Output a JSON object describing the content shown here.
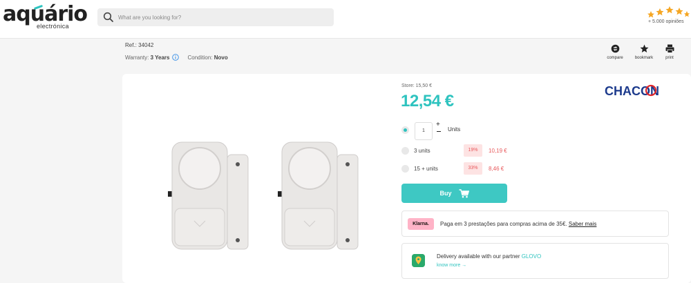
{
  "header": {
    "logo_main": "aquário",
    "logo_sub": "electrónica",
    "search_placeholder": "What are you looking for?",
    "rating_text": "+ 5.000 opiniões",
    "icons": {
      "search": "search-icon",
      "stars": "star-icon"
    },
    "colors": {
      "stars": "#f5a623",
      "accent": "#2ec3bf"
    }
  },
  "product": {
    "ref": "Ref.: 34042",
    "warranty_label": "Warranty:",
    "warranty_value": "3 Years",
    "condition_label": "Condition:",
    "condition_value": "Novo",
    "store_price": "Store: 15,50 €",
    "price": "12,54 €",
    "brand": "CHACON",
    "brand_color": "#1c3a8c"
  },
  "actions": {
    "compare": "compare",
    "bookmark": "bookmark",
    "print": "print"
  },
  "purchase": {
    "quantity": "1",
    "qty_plus": "+",
    "units_label": "Units",
    "tiers": [
      {
        "label": "3 units",
        "discount": "19%",
        "price": "10,19 €"
      },
      {
        "label": "15 + units",
        "discount": "33%",
        "price": "8,46 €"
      }
    ],
    "buy_label": "Buy",
    "selected_option": 0
  },
  "klarna": {
    "logo": "Klarna.",
    "text": "Paga em 3 prestações para compras acima de 35€.",
    "link": "Saber mais"
  },
  "delivery": {
    "text": "Delivery available with our partner",
    "partner": "GLOVO",
    "know_more": "know more →"
  }
}
